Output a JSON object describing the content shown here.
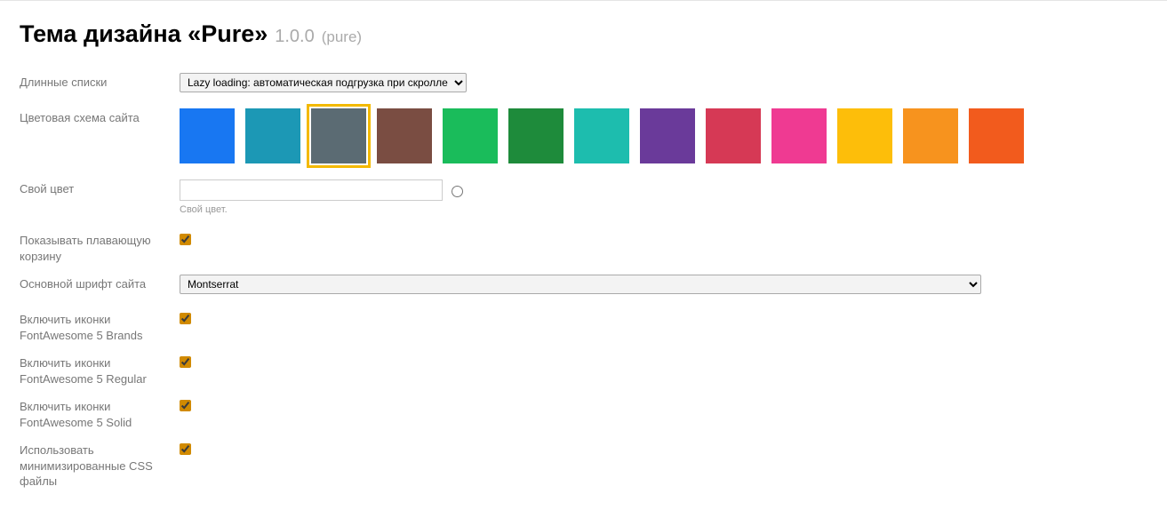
{
  "title": {
    "main": "Тема дизайна «Pure»",
    "version": "1.0.0",
    "slug": "(pure)"
  },
  "fields": {
    "long_lists": {
      "label": "Длинные списки",
      "value": "Lazy loading: автоматическая подгрузка при скролле"
    },
    "color_scheme": {
      "label": "Цветовая схема сайта",
      "swatches": [
        {
          "color": "#1877f2",
          "selected": false
        },
        {
          "color": "#1c98b5",
          "selected": false
        },
        {
          "color": "#5b6b73",
          "selected": true
        },
        {
          "color": "#7a4d42",
          "selected": false
        },
        {
          "color": "#1abc5b",
          "selected": false
        },
        {
          "color": "#1e8b3b",
          "selected": false
        },
        {
          "color": "#1dbdae",
          "selected": false
        },
        {
          "color": "#6a3a9a",
          "selected": false
        },
        {
          "color": "#d63955",
          "selected": false
        },
        {
          "color": "#ef3a92",
          "selected": false
        },
        {
          "color": "#fdbe0a",
          "selected": false
        },
        {
          "color": "#f7931e",
          "selected": false
        },
        {
          "color": "#f25b1d",
          "selected": false
        }
      ]
    },
    "custom_color": {
      "label": "Свой цвет",
      "value": "",
      "hint": "Свой цвет."
    },
    "floating_cart": {
      "label": "Показывать плавающую корзину",
      "checked": true
    },
    "main_font": {
      "label": "Основной шрифт сайта",
      "value": "Montserrat"
    },
    "fa_brands": {
      "label": "Включить иконки FontAwesome 5 Brands",
      "checked": true
    },
    "fa_regular": {
      "label": "Включить иконки FontAwesome 5 Regular",
      "checked": true
    },
    "fa_solid": {
      "label": "Включить иконки FontAwesome 5 Solid",
      "checked": true
    },
    "use_minified": {
      "label": "Использовать минимизированные CSS файлы",
      "checked": true
    }
  }
}
